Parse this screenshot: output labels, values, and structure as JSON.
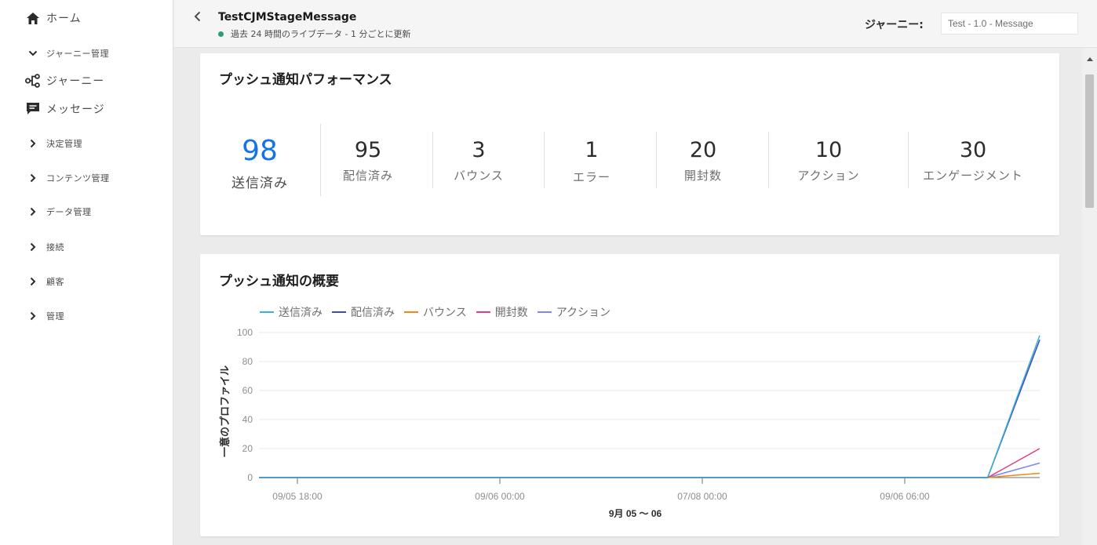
{
  "sidebar": {
    "items": [
      {
        "label": "ホーム",
        "icon": "home-icon"
      },
      {
        "label": "ジャーニー管理",
        "icon": "chevron-down-icon"
      },
      {
        "label": "ジャーニー",
        "icon": "journey-icon"
      },
      {
        "label": "メッセージ",
        "icon": "message-icon"
      },
      {
        "label": "決定管理",
        "icon": "chevron-right-icon"
      },
      {
        "label": "コンテンツ管理",
        "icon": "chevron-right-icon"
      },
      {
        "label": "データ管理",
        "icon": "chevron-right-icon"
      },
      {
        "label": "接続",
        "icon": "chevron-right-icon"
      },
      {
        "label": "顧客",
        "icon": "chevron-right-icon"
      },
      {
        "label": "管理",
        "icon": "chevron-right-icon"
      }
    ]
  },
  "header": {
    "title": "TestCJMStageMessage",
    "subtitle": "過去 24 時間のライブデータ - 1 分ごとに更新",
    "journey_label": "ジャーニー:",
    "journey_value": "Test - 1.0 - Message"
  },
  "performance": {
    "title": "プッシュ通知パフォーマンス",
    "metrics": [
      {
        "value": "98",
        "label": "送信済み"
      },
      {
        "value": "95",
        "label": "配信済み"
      },
      {
        "value": "3",
        "label": "バウンス"
      },
      {
        "value": "1",
        "label": "エラー"
      },
      {
        "value": "20",
        "label": "開封数"
      },
      {
        "value": "10",
        "label": "アクション"
      },
      {
        "value": "30",
        "label": "エンゲージメント"
      }
    ]
  },
  "overview": {
    "title": "プッシュ通知の概要"
  },
  "colors": {
    "accent": "#1473e6",
    "sent": "#38b2d1",
    "delivered": "#4046ca",
    "bounce": "#f68511",
    "opens": "#de3d82",
    "actions": "#7e84fa"
  },
  "chart_data": {
    "type": "line",
    "title": "",
    "ylabel": "一意のプロファイル",
    "xlabel": "9月 05 ～ 06",
    "ylim": [
      0,
      100
    ],
    "yticks": [
      "0",
      "20",
      "40",
      "60",
      "80",
      "100"
    ],
    "xtick_labels": [
      "09/05 18:00",
      "09/06 00:00",
      "07/08 00:00",
      "09/06 06:00"
    ],
    "x": [
      0,
      1,
      2,
      3,
      4,
      5,
      6,
      7,
      8,
      9,
      10,
      11,
      12,
      13,
      14,
      15
    ],
    "series": [
      {
        "name": "送信済み",
        "color": "#38b2d1",
        "values": [
          0,
          0,
          0,
          0,
          0,
          0,
          0,
          0,
          0,
          0,
          0,
          0,
          0,
          0,
          0,
          98
        ]
      },
      {
        "name": "配信済み",
        "color": "#4046ca",
        "values": [
          0,
          0,
          0,
          0,
          0,
          0,
          0,
          0,
          0,
          0,
          0,
          0,
          0,
          0,
          0,
          95
        ]
      },
      {
        "name": "バウンス",
        "color": "#f68511",
        "values": [
          0,
          0,
          0,
          0,
          0,
          0,
          0,
          0,
          0,
          0,
          0,
          0,
          0,
          0,
          0,
          3
        ]
      },
      {
        "name": "開封数",
        "color": "#de3d82",
        "values": [
          0,
          0,
          0,
          0,
          0,
          0,
          0,
          0,
          0,
          0,
          0,
          0,
          0,
          0,
          0,
          20
        ]
      },
      {
        "name": "アクション",
        "color": "#7e84fa",
        "values": [
          0,
          0,
          0,
          0,
          0,
          0,
          0,
          0,
          0,
          0,
          0,
          0,
          0,
          0,
          0,
          10
        ]
      }
    ],
    "grid": true,
    "legend": "top-left"
  }
}
